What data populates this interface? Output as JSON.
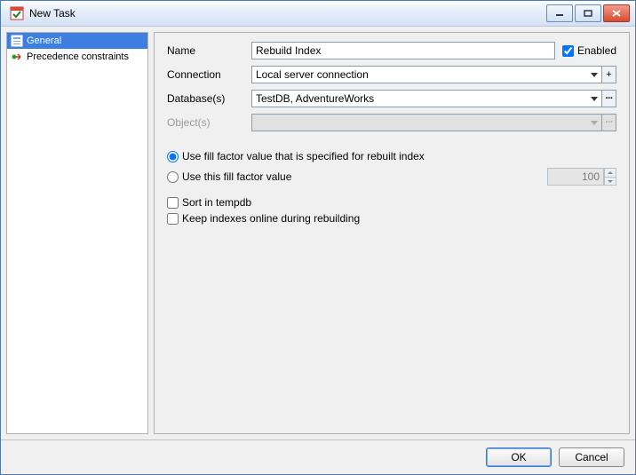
{
  "window": {
    "title": "New Task"
  },
  "sidebar": {
    "items": [
      {
        "label": "General"
      },
      {
        "label": "Precedence constraints"
      }
    ]
  },
  "form": {
    "name_label": "Name",
    "name_value": "Rebuild Index",
    "enabled_label": "Enabled",
    "connection_label": "Connection",
    "connection_value": "Local server connection",
    "databases_label": "Database(s)",
    "databases_value": "TestDB, AdventureWorks",
    "objects_label": "Object(s)",
    "objects_value": "",
    "fillfactor_specified_label": "Use fill factor value that is specified for rebuilt index",
    "fillfactor_custom_label": "Use this fill factor value",
    "fillfactor_value": "100",
    "sort_tempdb_label": "Sort in tempdb",
    "keep_online_label": "Keep indexes online during rebuilding"
  },
  "buttons": {
    "ok": "OK",
    "cancel": "Cancel"
  }
}
